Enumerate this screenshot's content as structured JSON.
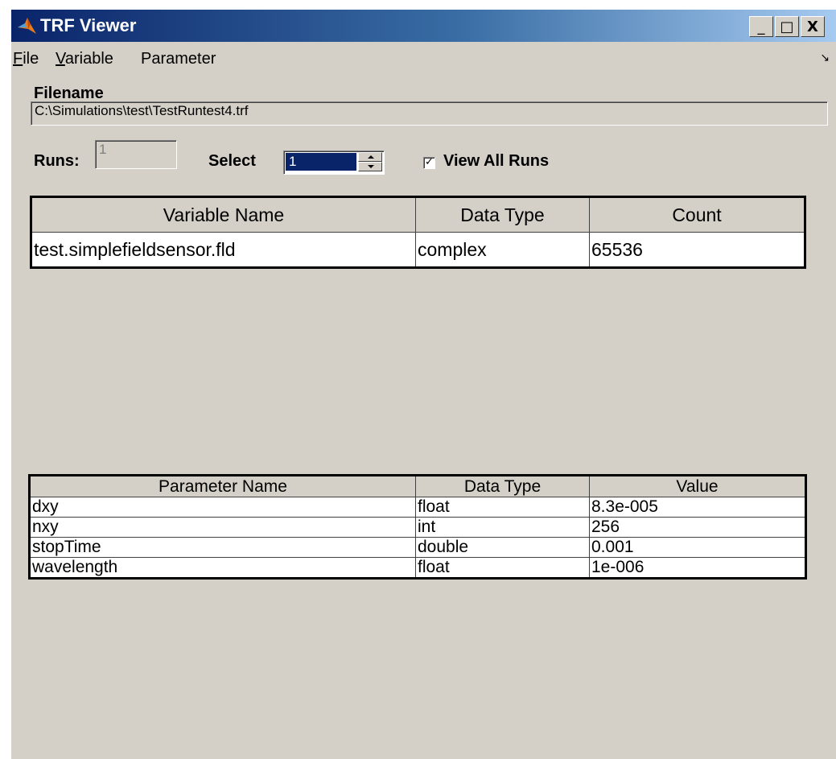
{
  "window": {
    "title": "TRF Viewer",
    "controls": {
      "minimize": "_",
      "maximize": "□",
      "close": "X"
    }
  },
  "menubar": {
    "items": [
      {
        "key": "F",
        "rest": "ile"
      },
      {
        "key": "V",
        "rest": "ariable"
      },
      {
        "key": "",
        "rest": "Parameter"
      }
    ],
    "dock_icon": "dock-arrow-icon"
  },
  "filename": {
    "label": "Filename",
    "value": "C:\\Simulations\\test\\TestRuntest4.trf"
  },
  "runs": {
    "label": "Runs:",
    "value": "1"
  },
  "select": {
    "label": "Select",
    "value": "1"
  },
  "view_all_runs": {
    "label": "View All Runs",
    "checked": true
  },
  "variables_table": {
    "columns": [
      "Variable Name",
      "Data Type",
      "Count"
    ],
    "rows": [
      [
        "test.simplefieldsensor.fld",
        "complex",
        "65536"
      ]
    ]
  },
  "parameters_table": {
    "columns": [
      "Parameter Name",
      "Data Type",
      "Value"
    ],
    "rows": [
      [
        "dxy",
        "float",
        "8.3e-005"
      ],
      [
        "nxy",
        "int",
        "256"
      ],
      [
        "stopTime",
        "double",
        "0.001"
      ],
      [
        "wavelength",
        "float",
        "1e-006"
      ]
    ]
  }
}
